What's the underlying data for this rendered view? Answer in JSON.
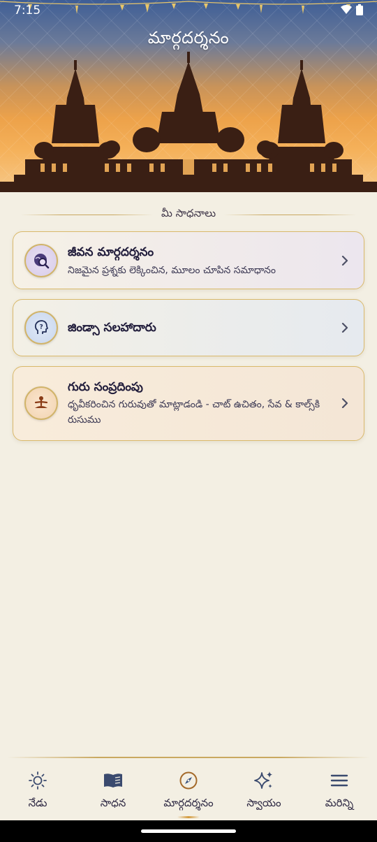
{
  "status_bar": {
    "time": "7:15"
  },
  "header": {
    "title": "మార్గదర్శనం"
  },
  "section": {
    "heading": "మీ సాధనాలు"
  },
  "cards": [
    {
      "title": "జీవన మార్గదర్శనం",
      "subtitle": "నిజమైన ప్రశ్నకు లెక్కించిన, మూలం చూపిన సమాధానం",
      "icon": "search-globe-icon"
    },
    {
      "title": "జిండ్సా సలహాదారు",
      "subtitle": "",
      "icon": "head-question-icon"
    },
    {
      "title": "గురు సంప్రదింపు",
      "subtitle": "ధృవీకరించిన గురువుతో మాట్లాడండి - చాట్ ఉచితం, సేవ & కాల్స్‌కి రుసుము",
      "icon": "meditation-icon"
    }
  ],
  "bottom_nav": {
    "items": [
      {
        "label": "నేడు",
        "icon": "sun-icon",
        "active": false
      },
      {
        "label": "సాధన",
        "icon": "book-icon",
        "active": false
      },
      {
        "label": "మార్గదర్శనం",
        "icon": "compass-icon",
        "active": true
      },
      {
        "label": "స్వాయం",
        "icon": "sparkles-icon",
        "active": false
      },
      {
        "label": "మరిన్ని",
        "icon": "menu-icon",
        "active": false
      }
    ]
  },
  "colors": {
    "accent_gold": "#c9a860",
    "background": "#f3efe3",
    "text_dark": "#1f1b3a"
  }
}
